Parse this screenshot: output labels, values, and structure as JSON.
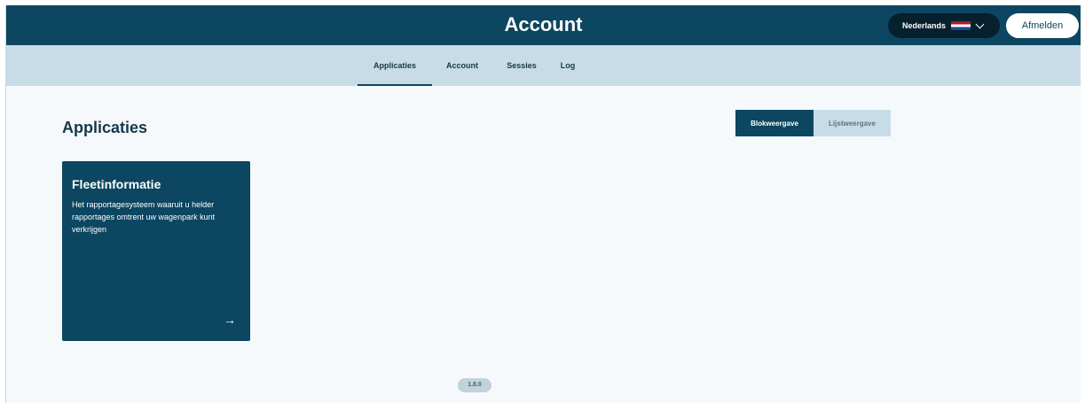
{
  "header": {
    "title": "Account",
    "language": {
      "label": "Nederlands",
      "flag_icon": "netherlands-flag-icon",
      "chevron_icon": "chevron-down-icon"
    },
    "logout_label": "Afmelden"
  },
  "nav": {
    "tabs": [
      {
        "label": "Applicaties",
        "active": true
      },
      {
        "label": "Account",
        "active": false
      },
      {
        "label": "Sessies",
        "active": false
      },
      {
        "label": "Log",
        "active": false
      }
    ]
  },
  "main": {
    "section_title": "Applicaties",
    "view_toggle": {
      "tile_label": "Blokweergave",
      "list_label": "Lijstweergave",
      "selected": "Blokweergave"
    },
    "cards": [
      {
        "title": "Fleetinformatie",
        "description": "Het rapportagesysteem waaruit u helder rapportages omtrent uw wagenpark kunt verkrijgen",
        "arrow_icon": "arrow-right-icon"
      }
    ]
  },
  "footer": {
    "version": "1.8.0"
  },
  "colors": {
    "primary": "#0c4661",
    "nav_background": "#c7dce6",
    "page_background": "#f5f9fc"
  }
}
